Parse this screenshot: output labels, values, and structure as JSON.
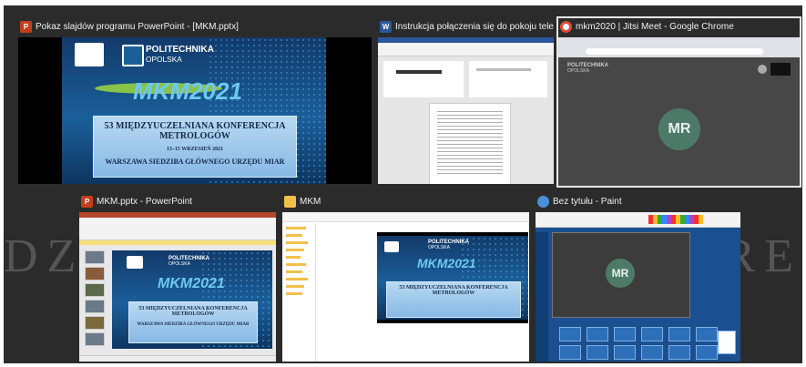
{
  "background_text": {
    "left": "DZY",
    "right": "RE"
  },
  "windows": [
    {
      "title": "Pokaz slajdów programu PowerPoint - [MKM.pptx]",
      "app": "powerpoint-slideshow",
      "icon_color": "#c43e1c",
      "icon_letter": "P"
    },
    {
      "title": "Instrukcja połączenia się do pokoju telekonferen...",
      "app": "word",
      "icon_color": "#2b579a",
      "icon_letter": "W"
    },
    {
      "title": "mkm2020 | Jitsi Meet - Google Chrome",
      "app": "chrome",
      "icon_color": "#dd4b39",
      "icon_letter": "",
      "selected": true
    },
    {
      "title": "MKM.pptx - PowerPoint",
      "app": "powerpoint",
      "icon_color": "#c43e1c",
      "icon_letter": "P"
    },
    {
      "title": "MKM",
      "app": "explorer",
      "icon_color": "#f2c04a",
      "icon_letter": ""
    },
    {
      "title": "Bez tytułu - Paint",
      "app": "paint",
      "icon_color": "#4a90d9",
      "icon_letter": ""
    }
  ],
  "slide": {
    "logo_line1": "POLITECHNIKA",
    "logo_line2": "OPOLSKA",
    "brand": "MKM2021",
    "conf_line1": "53 MIĘDZYUCZELNIANA KONFERENCJA",
    "conf_line2": "METROLOGÓW",
    "dates": "13–15 WRZESIEŃ 2021",
    "venue": "WARSZAWA SIEDZIBA GŁÓWNEGO URZĘDU MIAR"
  },
  "jitsi": {
    "initials": "MR",
    "logo_line1": "POLITECHNIKA",
    "logo_line2": "OPOLSKA"
  },
  "paint": {
    "initials": "MR"
  }
}
